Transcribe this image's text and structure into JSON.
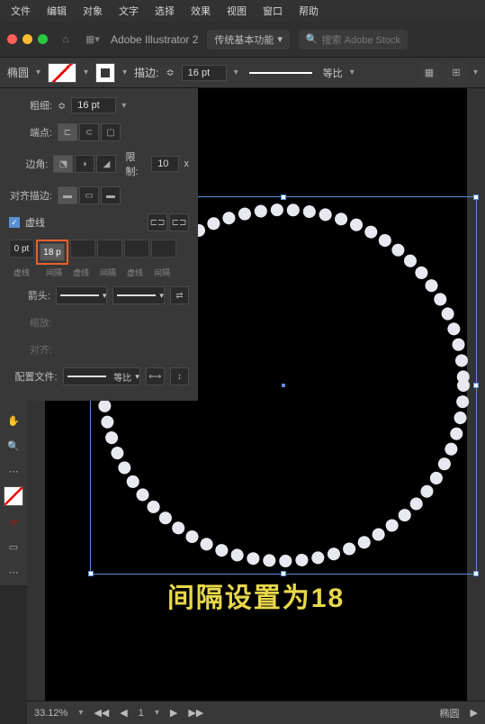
{
  "menu": [
    "文件",
    "编辑",
    "对象",
    "文字",
    "选择",
    "效果",
    "视图",
    "窗口",
    "帮助"
  ],
  "header": {
    "app_title": "Adobe Illustrator 2",
    "preset": "传统基本功能",
    "search_placeholder": "搜索 Adobe Stock"
  },
  "control": {
    "object_label": "椭圆",
    "stroke_label": "描边:",
    "stroke_weight": "16 pt",
    "profile_label": "等比"
  },
  "stroke_panel": {
    "weight_label": "粗细:",
    "weight_value": "16 pt",
    "cap_label": "端点:",
    "corner_label": "边角:",
    "limit_label": "限制:",
    "limit_value": "10",
    "limit_suffix": "x",
    "align_label": "对齐描边:",
    "dash_checkbox_label": "虚线",
    "dash_value_0": "0 pt",
    "dash_value_1": "18 p",
    "dash_labels": [
      "虚线",
      "间隔",
      "虚线",
      "间隔",
      "虚线",
      "间隔"
    ],
    "arrow_label": "箭头:",
    "scale_label": "缩放:",
    "align_arrow_label": "对齐:",
    "profile_label": "配置文件:",
    "profile_value": "等比"
  },
  "canvas": {
    "caption": "间隔设置为18"
  },
  "status": {
    "zoom": "33.12%",
    "page": "1",
    "layer": "椭圆"
  }
}
